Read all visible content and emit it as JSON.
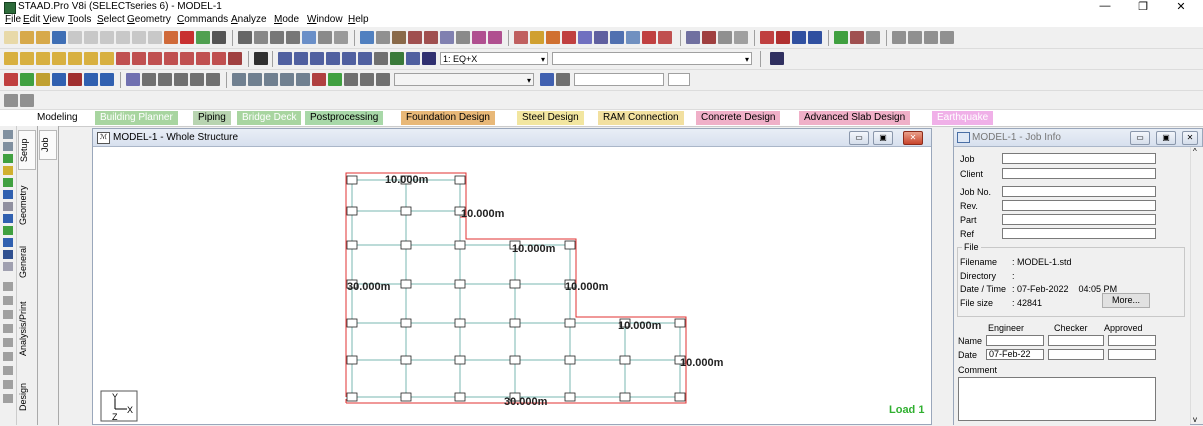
{
  "window": {
    "title": "STAAD.Pro V8i (SELECTseries 6) - MODEL-1",
    "minimize": "—",
    "restore": "❐",
    "close": "✕"
  },
  "menu": [
    "File",
    "Edit",
    "View",
    "Tools",
    "Select",
    "Geometry",
    "Commands",
    "Analyze",
    "Mode",
    "Window",
    "Help"
  ],
  "toolbar": {
    "load_combo": "1: EQ+X",
    "empty_combo": ""
  },
  "page_tabs": [
    {
      "label": "Modeling",
      "color": "#ffffff",
      "text": "#000000"
    },
    {
      "label": "Building Planner",
      "color": "#a8d5a0",
      "text": "#ffffff"
    },
    {
      "label": "Piping",
      "color": "#b8d4b0",
      "text": "#000000"
    },
    {
      "label": "Bridge Deck",
      "color": "#a8d5a0",
      "text": "#ffffff"
    },
    {
      "label": "Postprocessing",
      "color": "#a8d8a8",
      "text": "#000000"
    },
    {
      "label": "Foundation Design",
      "color": "#e8b878",
      "text": "#000000"
    },
    {
      "label": "Steel Design",
      "color": "#f2e6a0",
      "text": "#000000"
    },
    {
      "label": "RAM Connection",
      "color": "#f2e0a0",
      "text": "#000000"
    },
    {
      "label": "Concrete Design",
      "color": "#f0b0c8",
      "text": "#000000"
    },
    {
      "label": "Advanced Slab Design",
      "color": "#f0b0c8",
      "text": "#000000"
    },
    {
      "label": "Earthquake",
      "color": "#f0b0e8",
      "text": "#ffffff"
    }
  ],
  "side_tabs": [
    "Setup",
    "Geometry",
    "General",
    "Analysis/Print",
    "Design"
  ],
  "sub_tabs": [
    "Job"
  ],
  "main_window": {
    "title": "MODEL-1 - Whole Structure",
    "load_label": "Load 1",
    "dimensions": [
      "10.000m",
      "10.000m",
      "10.000m",
      "30.000m",
      "10.000m",
      "10.000m",
      "10.000m",
      "30.000m"
    ],
    "axis_x": "X",
    "axis_y": "Y",
    "axis_z": "Z"
  },
  "job_info": {
    "title": "MODEL-1 - Job Info",
    "fields": [
      {
        "label": "Job",
        "value": ""
      },
      {
        "label": "Client",
        "value": ""
      },
      {
        "label": "Job No.",
        "value": ""
      },
      {
        "label": "Rev.",
        "value": ""
      },
      {
        "label": "Part",
        "value": ""
      },
      {
        "label": "Ref",
        "value": ""
      }
    ],
    "file_group": "File",
    "filename_label": "Filename",
    "filename_value": ": MODEL-1.std",
    "directory_label": "Directory",
    "directory_value": ":",
    "datetime_label": "Date / Time",
    "datetime_value": ": 07-Feb-2022    04:05 PM",
    "filesize_label": "File size",
    "filesize_value": ": 42841",
    "more_button": "More...",
    "col_engineer": "Engineer",
    "col_checker": "Checker",
    "col_approved": "Approved",
    "name_label": "Name",
    "date_label": "Date",
    "date_value": "07-Feb-22",
    "comment_label": "Comment"
  }
}
